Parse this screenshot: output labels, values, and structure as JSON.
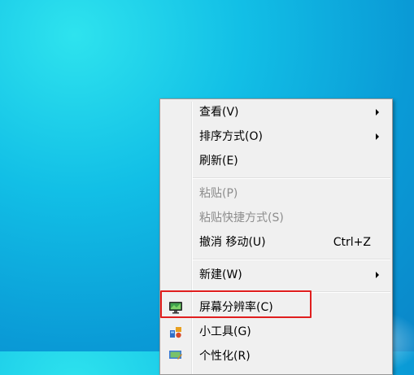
{
  "context_menu": {
    "items": [
      {
        "label": "查看(V)",
        "submenu": true,
        "disabled": false
      },
      {
        "label": "排序方式(O)",
        "submenu": true,
        "disabled": false
      },
      {
        "label": "刷新(E)",
        "submenu": false,
        "disabled": false
      },
      {
        "label": "粘贴(P)",
        "submenu": false,
        "disabled": true
      },
      {
        "label": "粘贴快捷方式(S)",
        "submenu": false,
        "disabled": true
      },
      {
        "label": "撤消 移动(U)",
        "shortcut": "Ctrl+Z",
        "submenu": false,
        "disabled": false
      },
      {
        "label": "新建(W)",
        "submenu": true,
        "disabled": false
      },
      {
        "label": "屏幕分辨率(C)",
        "icon": "display-icon",
        "submenu": false,
        "disabled": false
      },
      {
        "label": "小工具(G)",
        "icon": "gadgets-icon",
        "submenu": false,
        "disabled": false
      },
      {
        "label": "个性化(R)",
        "icon": "personalize-icon",
        "submenu": false,
        "disabled": false
      }
    ]
  },
  "colors": {
    "highlight_box": "#e01e1e",
    "menu_background": "#f0f0f0"
  }
}
